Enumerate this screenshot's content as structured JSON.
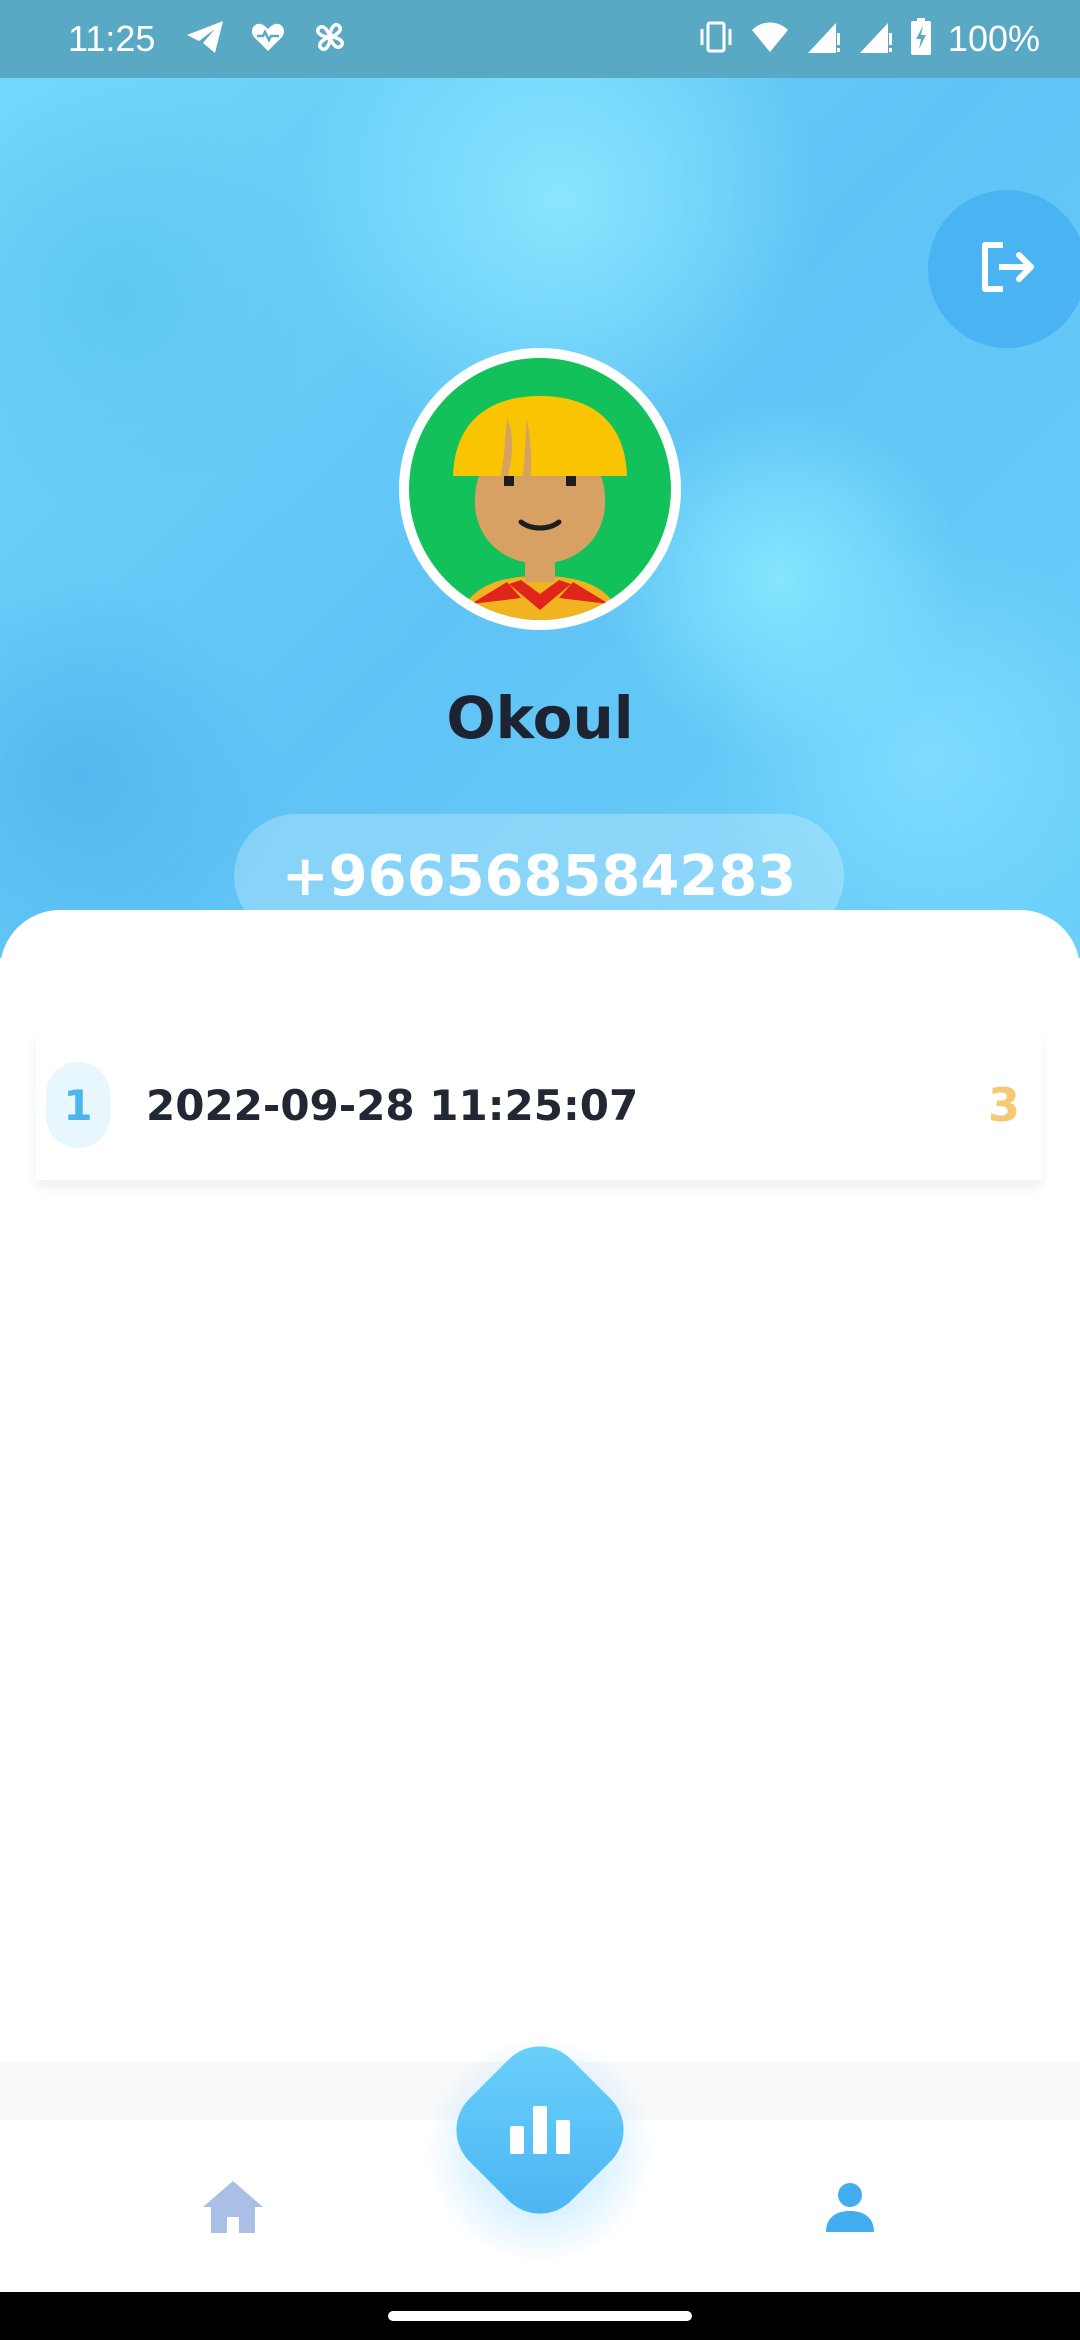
{
  "status_bar": {
    "time": "11:25",
    "battery_percent": "100%",
    "icons": [
      "telegram-icon",
      "health-icon",
      "fan-icon",
      "vibrate-icon",
      "wifi-icon",
      "signal-icon",
      "signal-icon",
      "battery-charging-icon"
    ]
  },
  "header": {
    "logout_icon": "logout-icon",
    "user_name": "Okoul",
    "phone": "+966568584283"
  },
  "history": [
    {
      "index": "1",
      "date": "2022-09-28 11:25:07",
      "score": "3"
    }
  ],
  "nav": {
    "items": [
      "home-icon",
      "stats-icon",
      "profile-icon"
    ],
    "active": "profile-icon"
  },
  "colors": {
    "accent": "#4ab3f2",
    "score": "#f7c873",
    "nav_inactive": "#a9bfe6"
  }
}
